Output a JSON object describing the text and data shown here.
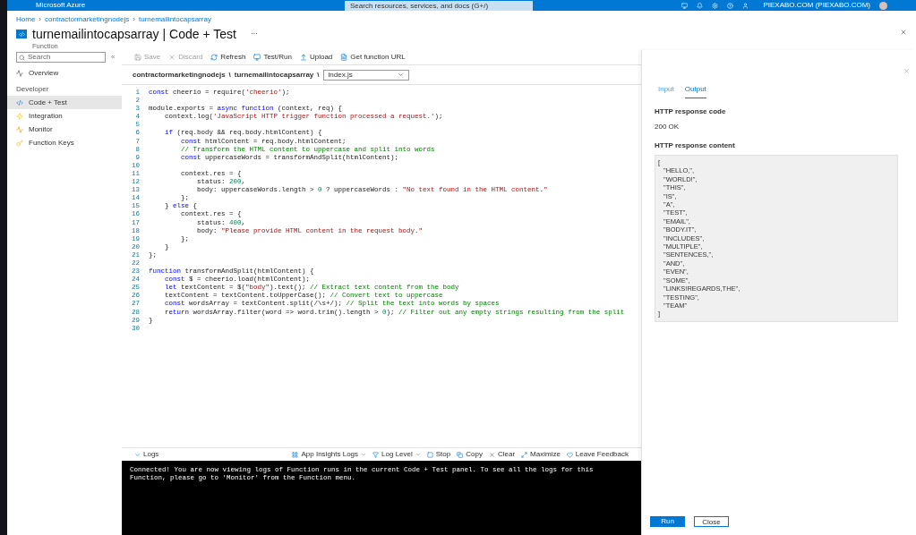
{
  "top_bar": {
    "brand": "Microsoft Azure",
    "search": {
      "placeholder": "Search resources, services, and docs (G+/)"
    },
    "account": "PIEXABO.COM (PIEXABO.COM)"
  },
  "breadcrumb": {
    "separator": "›",
    "links": [
      "Home",
      "contractormarketingnodejs",
      "turnemailintocapsarray"
    ]
  },
  "page": {
    "title": "turnemailintocapsarray | Code + Test",
    "subtitle": "Function",
    "more": "···"
  },
  "sidebar": {
    "search": {
      "placeholder": "Search"
    },
    "collapse": "«",
    "items": [
      {
        "label": "Overview",
        "selected": false
      }
    ],
    "sections": [
      {
        "heading": "Developer",
        "items": [
          {
            "label": "Code + Test",
            "selected": true
          },
          {
            "label": "Integration",
            "selected": false
          },
          {
            "label": "Monitor",
            "selected": false
          },
          {
            "label": "Function Keys",
            "selected": false
          }
        ]
      }
    ]
  },
  "toolbar": [
    {
      "label": "Save",
      "disabled": true
    },
    {
      "label": "Discard",
      "disabled": true
    },
    {
      "label": "Refresh",
      "disabled": false
    },
    {
      "label": "Test/Run",
      "disabled": false
    },
    {
      "label": "Upload",
      "disabled": false
    },
    {
      "label": "Get function URL",
      "disabled": false
    }
  ],
  "path": {
    "parts": [
      "contractormarketingnodejs",
      "turnemailintocapsarray"
    ],
    "separator": "\\",
    "file": "index.js"
  },
  "code": [
    {
      "number": "1",
      "tokens": [
        {
          "kind": "kw",
          "text": "const"
        },
        {
          "kind": "p",
          "text": " cheerio = require("
        },
        {
          "kind": "str",
          "text": "'cheerio'"
        },
        {
          "kind": "p",
          "text": ");"
        }
      ]
    },
    {
      "number": "2"
    },
    {
      "number": "3",
      "tokens": [
        {
          "kind": "p",
          "text": "module.exports = "
        },
        {
          "kind": "kw",
          "text": "async function"
        },
        {
          "kind": "p",
          "text": " (context, req) {"
        }
      ]
    },
    {
      "number": "4",
      "tokens": [
        {
          "kind": "p",
          "text": "    context.log("
        },
        {
          "kind": "str",
          "text": "'JavaScript HTTP trigger function processed a request.'"
        },
        {
          "kind": "p",
          "text": ");"
        }
      ]
    },
    {
      "number": "5"
    },
    {
      "number": "6",
      "tokens": [
        {
          "kind": "kw",
          "text": "    if"
        },
        {
          "kind": "p",
          "text": " (req.body && req.body.htmlContent) {"
        }
      ]
    },
    {
      "number": "7",
      "tokens": [
        {
          "kind": "kw",
          "text": "        const"
        },
        {
          "kind": "p",
          "text": " htmlContent = req.body.htmlContent;"
        }
      ]
    },
    {
      "number": "8",
      "tokens": [
        {
          "kind": "cmt",
          "text": "        // Transform the HTML content to uppercase and split into words"
        }
      ]
    },
    {
      "number": "9",
      "tokens": [
        {
          "kind": "kw",
          "text": "        const"
        },
        {
          "kind": "p",
          "text": " uppercaseWords = transformAndSplit(htmlContent);"
        }
      ]
    },
    {
      "number": "10"
    },
    {
      "number": "11",
      "tokens": [
        {
          "kind": "p",
          "text": "        context.res = {"
        }
      ]
    },
    {
      "number": "12",
      "tokens": [
        {
          "kind": "p",
          "text": "            status: "
        },
        {
          "kind": "num",
          "text": "200"
        },
        {
          "kind": "p",
          "text": ","
        }
      ]
    },
    {
      "number": "13",
      "tokens": [
        {
          "kind": "p",
          "text": "            body: uppercaseWords.length > "
        },
        {
          "kind": "num",
          "text": "0"
        },
        {
          "kind": "p",
          "text": " ? uppercaseWords : "
        },
        {
          "kind": "str",
          "text": "\"No text found in the HTML content.\""
        }
      ]
    },
    {
      "number": "14",
      "tokens": [
        {
          "kind": "p",
          "text": "        };"
        }
      ]
    },
    {
      "number": "15",
      "tokens": [
        {
          "kind": "p",
          "text": "    } "
        },
        {
          "kind": "kw",
          "text": "else"
        },
        {
          "kind": "p",
          "text": " {"
        }
      ]
    },
    {
      "number": "16",
      "tokens": [
        {
          "kind": "p",
          "text": "        context.res = {"
        }
      ]
    },
    {
      "number": "17",
      "tokens": [
        {
          "kind": "p",
          "text": "            status: "
        },
        {
          "kind": "num",
          "text": "400"
        },
        {
          "kind": "p",
          "text": ","
        }
      ]
    },
    {
      "number": "18",
      "tokens": [
        {
          "kind": "p",
          "text": "            body: "
        },
        {
          "kind": "str",
          "text": "\"Please provide HTML content in the request body.\""
        }
      ]
    },
    {
      "number": "19",
      "tokens": [
        {
          "kind": "p",
          "text": "        };"
        }
      ]
    },
    {
      "number": "20",
      "tokens": [
        {
          "kind": "p",
          "text": "    }"
        }
      ]
    },
    {
      "number": "21",
      "tokens": [
        {
          "kind": "p",
          "text": "};"
        }
      ]
    },
    {
      "number": "22"
    },
    {
      "number": "23",
      "tokens": [
        {
          "kind": "kw",
          "text": "function"
        },
        {
          "kind": "p",
          "text": " transformAndSplit(htmlContent) {"
        }
      ]
    },
    {
      "number": "24",
      "tokens": [
        {
          "kind": "kw",
          "text": "    const"
        },
        {
          "kind": "p",
          "text": " $ = cheerio.load(htmlContent);"
        }
      ]
    },
    {
      "number": "25",
      "tokens": [
        {
          "kind": "kw",
          "text": "    let"
        },
        {
          "kind": "p",
          "text": " textContent = $("
        },
        {
          "kind": "str",
          "text": "\"body\""
        },
        {
          "kind": "p",
          "text": ").text();"
        },
        {
          "kind": "cmt",
          "text": " // Extract text content from the body"
        }
      ]
    },
    {
      "number": "26",
      "tokens": [
        {
          "kind": "p",
          "text": "    textContent = textContent.toUpperCase();"
        },
        {
          "kind": "cmt",
          "text": " // Convert text to uppercase"
        }
      ]
    },
    {
      "number": "27",
      "tokens": [
        {
          "kind": "kw",
          "text": "    const"
        },
        {
          "kind": "p",
          "text": " wordsArray = textContent.split(/\\s+/);"
        },
        {
          "kind": "cmt",
          "text": " // Split the text into words by spaces"
        }
      ]
    },
    {
      "number": "28",
      "tokens": [
        {
          "kind": "kw",
          "text": "    return"
        },
        {
          "kind": "p",
          "text": " wordsArray.filter(word => word.trim().length > "
        },
        {
          "kind": "num",
          "text": "0"
        },
        {
          "kind": "p",
          "text": ");"
        },
        {
          "kind": "cmt",
          "text": " // Filter out any empty strings resulting from the split"
        }
      ]
    },
    {
      "number": "29",
      "tokens": [
        {
          "kind": "p",
          "text": "}"
        }
      ]
    },
    {
      "number": "30"
    }
  ],
  "logs": {
    "title": "Logs",
    "tools": [
      {
        "label": "App Insights Logs",
        "dropdown": true
      },
      {
        "label": "Log Level",
        "dropdown": true
      },
      {
        "label": "Stop",
        "dropdown": false
      },
      {
        "label": "Copy",
        "dropdown": false
      },
      {
        "label": "Clear",
        "dropdown": false
      },
      {
        "label": "Maximize",
        "dropdown": false
      },
      {
        "label": "Leave Feedback",
        "dropdown": false
      }
    ],
    "output": "Connected! You are now viewing logs of Function runs in the current Code + Test panel. To see all the logs for this Function, please go to 'Monitor' from the Function menu."
  },
  "test_panel": {
    "tabs": [
      {
        "label": "Input",
        "selected": false
      },
      {
        "label": "Output",
        "selected": true
      }
    ],
    "response_code": {
      "label": "HTTP response code",
      "value": "200 OK"
    },
    "response_content": {
      "label": "HTTP response content",
      "lines": [
        "[",
        "\"HELLO,\",",
        "\"WORLD!\",",
        "\"THIS\",",
        "\"IS\",",
        "\"A\",",
        "\"TEST\",",
        "\"EMAIL\",",
        "\"BODY.IT\",",
        "\"INCLUDES\",",
        "\"MULTIPLE\",",
        "\"SENTENCES,\",",
        "\"AND\",",
        "\"EVEN\",",
        "\"SOME\",",
        "\"LINKS!REGARDS,THE\",",
        "\"TESTING\",",
        "\"TEAM\"",
        "]"
      ]
    },
    "buttons": [
      {
        "label": "Run",
        "kind": "primary"
      },
      {
        "label": "Close",
        "kind": "secondary"
      }
    ]
  }
}
